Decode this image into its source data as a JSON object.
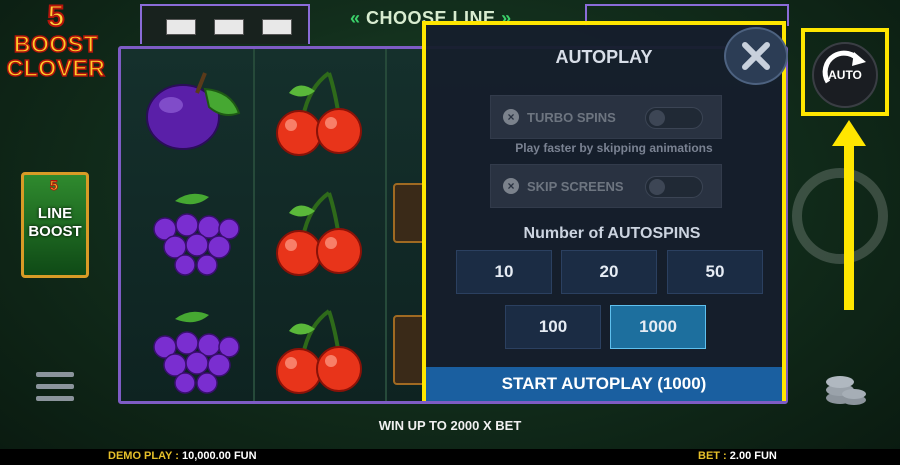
{
  "logo": {
    "number": "5",
    "line1": "BOOST",
    "line2": "CLOVER"
  },
  "line_boost": {
    "number": "5",
    "line1": "LINE",
    "line2": "BOOST"
  },
  "header": {
    "choose_line": "CHOOSE LINE"
  },
  "autoplay": {
    "title": "AUTOPLAY",
    "turbo_label": "TURBO SPINS",
    "turbo_hint": "Play faster by skipping animations",
    "skip_label": "SKIP SCREENS",
    "num_label": "Number of AUTOSPINS",
    "options": [
      "10",
      "20",
      "50",
      "100",
      "1000"
    ],
    "selected": "1000",
    "start_label": "START AUTOPLAY (1000)"
  },
  "auto_button": {
    "label": "AUTO"
  },
  "win_text": "WIN UP TO 2000 X BET",
  "footer": {
    "demo_label": "DEMO PLAY : ",
    "demo_value": "10,000.00 FUN",
    "bet_label": "BET : ",
    "bet_value": "2.00 FUN"
  },
  "colors": {
    "highlight": "#ffe600",
    "start_button": "#1a5fa0",
    "selected_option": "#1d6f9e"
  },
  "reel_symbols": [
    [
      "plum",
      "cherry"
    ],
    [
      "grapes",
      "cherry"
    ],
    [
      "grapes",
      "cherry"
    ]
  ]
}
